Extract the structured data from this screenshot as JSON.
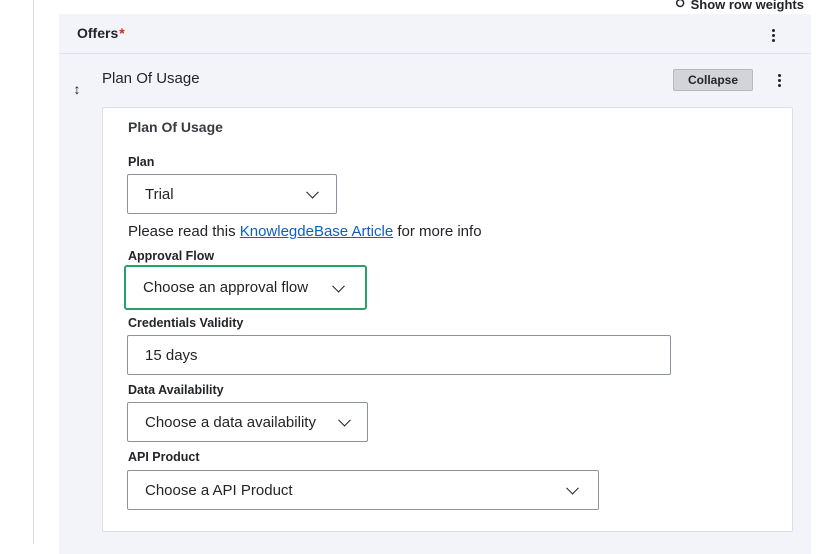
{
  "top_link": {
    "label": "Show row weights",
    "icon": "eye-icon"
  },
  "offers": {
    "title": "Offers",
    "required_mark": "*"
  },
  "row": {
    "title": "Plan Of Usage",
    "collapse_label": "Collapse",
    "drag_icon": "drag-handle-icon"
  },
  "card": {
    "title": "Plan Of Usage",
    "plan": {
      "label": "Plan",
      "value": "Trial"
    },
    "info": {
      "prefix": "Please read this ",
      "link_text": "KnowlegdeBase Article",
      "suffix": " for more info"
    },
    "approval_flow": {
      "label": "Approval Flow",
      "value": "Choose an approval flow"
    },
    "credentials_validity": {
      "label": "Credentials Validity",
      "value": "15 days"
    },
    "data_availability": {
      "label": "Data Availability",
      "value": "Choose a data availability"
    },
    "api_product": {
      "label": "API Product",
      "value": "Choose a API Product"
    }
  },
  "colors": {
    "focus_border": "#26a269",
    "link": "#0b5fc5",
    "required": "#d72222",
    "panel_bg": "#f3f4f9"
  }
}
